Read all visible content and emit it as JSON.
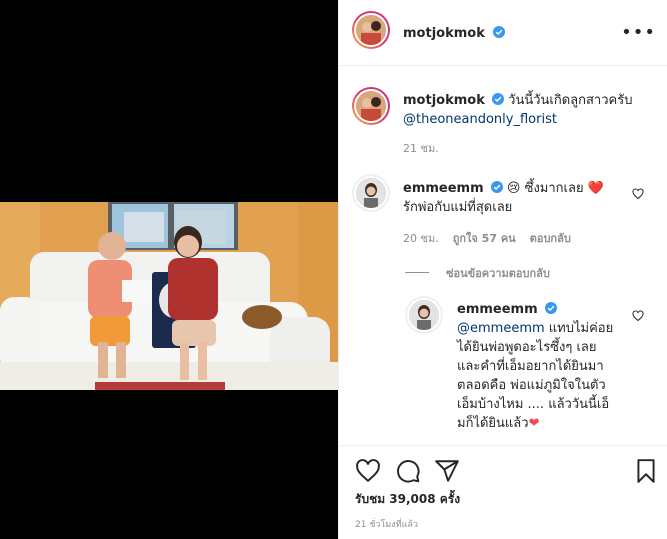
{
  "post": {
    "username": "motjokmok",
    "more_label": "•••",
    "caption_text": "วันนี้วันเกิดลูกสาวครับ",
    "caption_mention": "@theoneandonly_florist",
    "caption_time": "21 ชม."
  },
  "comments": [
    {
      "username": "emmeemm",
      "emoji": "😢",
      "line1": "ซึ้งมากเลย",
      "heart": "❤️",
      "line2": "รักพ่อกับแม่ที่สุดเลย",
      "time": "20 ชม.",
      "likes": "ถูกใจ 57 คน",
      "reply": "ตอบกลับ"
    }
  ],
  "hide_replies_label": "ซ่อนข้อความตอบกลับ",
  "reply": {
    "username": "emmeemm",
    "mention": "@emmeemm",
    "lines": [
      " แทบไม่ค่อย",
      "ได้ยินพ่อพูดอะไรซึ้งๆ เลย",
      "และคำที่เอ็มอยากได้ยินมา",
      "ตลอดคือ พ่อแม่ภูมิใจในตัว",
      "เอ็มบ้างไหม .... แล้ววันนี้เอ็"
    ],
    "last_line": "มก็ได้ยินแล้ว"
  },
  "likes_text": "รับชม 39,008 ครั้ง",
  "post_time": "21 ชั่วโมงที่แล้ว",
  "icons": [
    "heart-icon",
    "comment-icon",
    "share-icon",
    "bookmark-icon",
    "verified-icon",
    "more-icon"
  ],
  "colors": {
    "verified": "#3897f0",
    "heart": "#ed4956",
    "link": "#00376b",
    "muted": "#8e8e8e"
  }
}
